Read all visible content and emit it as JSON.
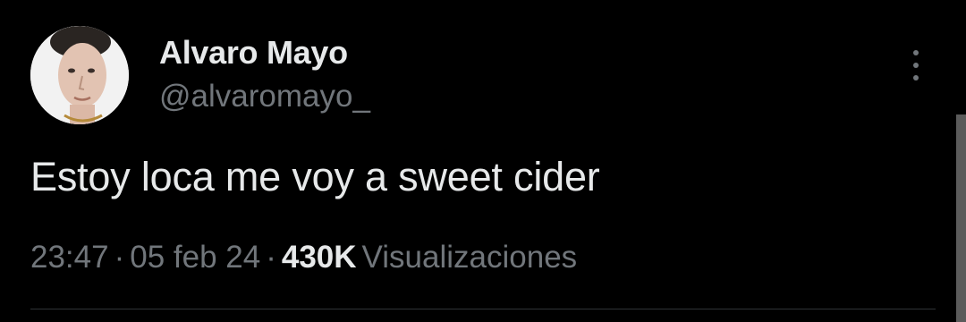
{
  "tweet": {
    "author": {
      "display_name": "Alvaro Mayo",
      "handle": "@alvaromayo_"
    },
    "text": "Estoy loca me voy a sweet cider",
    "meta": {
      "time": "23:47",
      "separator": "·",
      "date": "05 feb 24",
      "views_count": "430K",
      "views_label": "Visualizaciones"
    },
    "more_icon": "more-vertical-icon"
  },
  "colors": {
    "background": "#000000",
    "primary_text": "#e7e9ea",
    "secondary_text": "#71767b",
    "divider": "#2f3336"
  }
}
